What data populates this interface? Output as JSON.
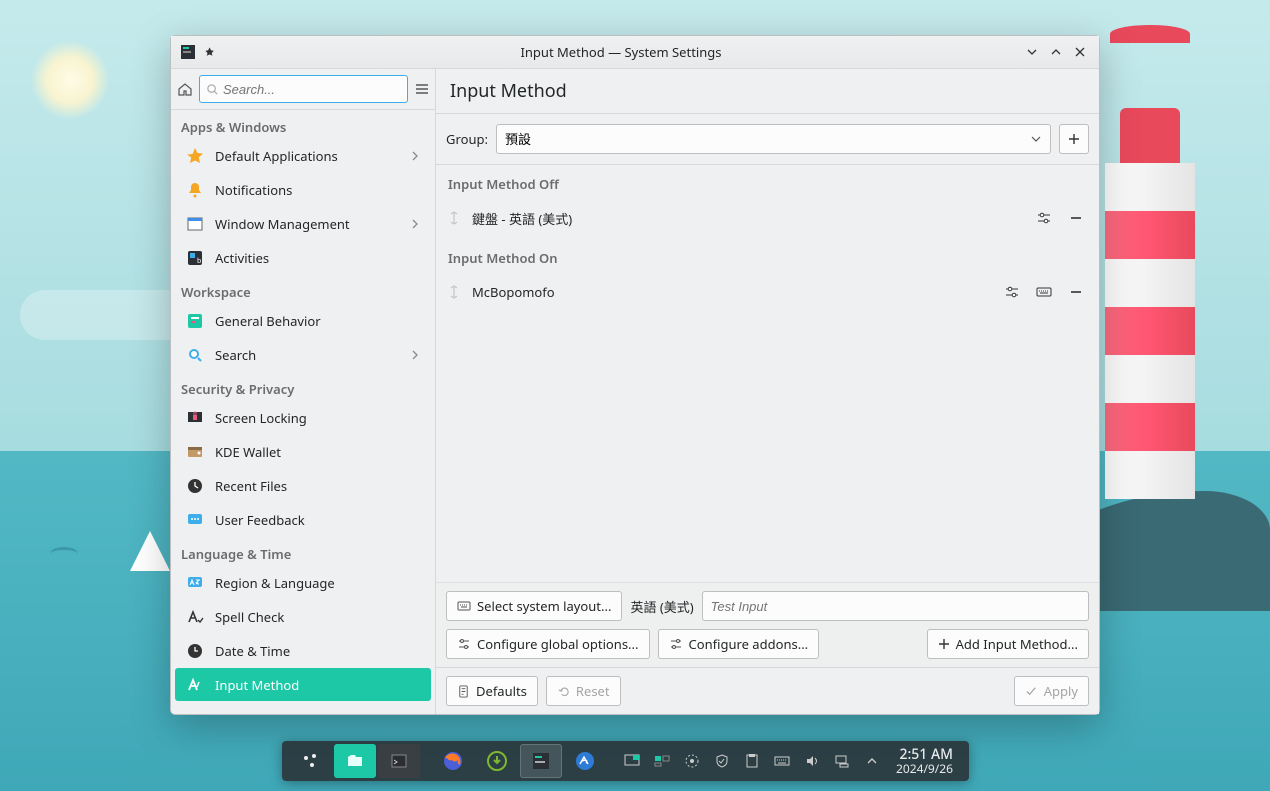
{
  "window": {
    "title": "Input Method — System Settings"
  },
  "sidebar": {
    "search_placeholder": "Search...",
    "sections": [
      {
        "title": "Apps & Windows",
        "items": [
          {
            "label": "Default Applications",
            "icon": "star",
            "color": "#f5a623",
            "chevron": true
          },
          {
            "label": "Notifications",
            "icon": "bell",
            "color": "#f5a623",
            "chevron": false
          },
          {
            "label": "Window Management",
            "icon": "window",
            "color": "#3d8fe9",
            "chevron": true
          },
          {
            "label": "Activities",
            "icon": "activities",
            "color": "#2b2f36",
            "chevron": false
          }
        ]
      },
      {
        "title": "Workspace",
        "items": [
          {
            "label": "General Behavior",
            "icon": "behavior",
            "color": "#1cc8a5",
            "chevron": false
          },
          {
            "label": "Search",
            "icon": "search",
            "color": "#3daee9",
            "chevron": true
          }
        ]
      },
      {
        "title": "Security & Privacy",
        "items": [
          {
            "label": "Screen Locking",
            "icon": "lock",
            "color": "#e85c7b",
            "chevron": false
          },
          {
            "label": "KDE Wallet",
            "icon": "wallet",
            "color": "#c49968",
            "chevron": false
          },
          {
            "label": "Recent Files",
            "icon": "clock",
            "color": "#333",
            "chevron": false
          },
          {
            "label": "User Feedback",
            "icon": "feedback",
            "color": "#3daee9",
            "chevron": false
          }
        ]
      },
      {
        "title": "Language & Time",
        "items": [
          {
            "label": "Region & Language",
            "icon": "lang",
            "color": "#3daee9",
            "chevron": false
          },
          {
            "label": "Spell Check",
            "icon": "spell",
            "color": "#333",
            "chevron": false
          },
          {
            "label": "Date & Time",
            "icon": "datetime",
            "color": "#333",
            "chevron": false
          },
          {
            "label": "Input Method",
            "icon": "input",
            "color": "#fff",
            "chevron": false,
            "active": true
          }
        ]
      }
    ]
  },
  "content": {
    "title": "Input Method",
    "group_label": "Group:",
    "group_selected": "預設",
    "section_off": "Input Method Off",
    "section_on": "Input Method On",
    "ims_off": [
      {
        "name": "鍵盤 - 英語 (美式)"
      }
    ],
    "ims_on": [
      {
        "name": "McBopomofo",
        "has_kb": true
      }
    ],
    "select_layout_label": "Select system layout...",
    "layout_value": "英語 (美式)",
    "test_input_placeholder": "Test Input",
    "configure_global": "Configure global options...",
    "configure_addons": "Configure addons...",
    "add_im": "Add Input Method...",
    "defaults_label": "Defaults",
    "reset_label": "Reset",
    "apply_label": "Apply"
  },
  "taskbar": {
    "time": "2:51 AM",
    "date": "2024/9/26"
  }
}
